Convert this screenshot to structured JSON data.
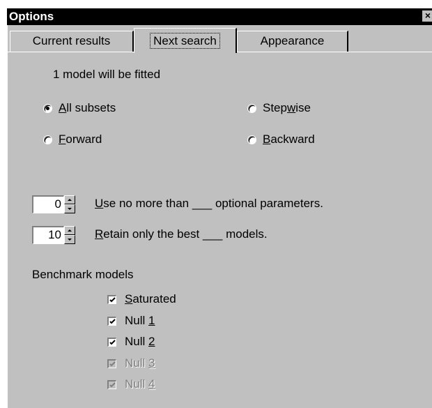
{
  "window": {
    "title": "Options",
    "close_glyph": "×"
  },
  "tabs": [
    {
      "label": "Current results",
      "active": false
    },
    {
      "label": "Next search",
      "active": true
    },
    {
      "label": "Appearance",
      "active": false
    }
  ],
  "summary": "1 model will be fitted",
  "method": {
    "options": [
      {
        "pre": "",
        "key": "A",
        "post": "ll subsets",
        "selected": true
      },
      {
        "pre": "Step",
        "key": "w",
        "post": "ise",
        "selected": false
      },
      {
        "pre": "",
        "key": "F",
        "post": "orward",
        "selected": false
      },
      {
        "pre": "",
        "key": "B",
        "post": "ackward",
        "selected": false
      }
    ]
  },
  "limits": {
    "max_optional": {
      "value": "0",
      "key": "U",
      "label_rest": "se no more than ___ optional parameters."
    },
    "retain_best": {
      "value": "10",
      "key": "R",
      "label_rest": "etain only the best ___ models."
    }
  },
  "benchmark": {
    "heading": "Benchmark models",
    "items": [
      {
        "pre": "",
        "key": "S",
        "post": "aturated",
        "checked": true,
        "enabled": true
      },
      {
        "pre": "Null ",
        "key": "1",
        "post": "",
        "checked": true,
        "enabled": true
      },
      {
        "pre": "Null ",
        "key": "2",
        "post": "",
        "checked": true,
        "enabled": true
      },
      {
        "pre": "Null ",
        "key": "3",
        "post": "",
        "checked": true,
        "enabled": false
      },
      {
        "pre": "Null ",
        "key": "4",
        "post": "",
        "checked": true,
        "enabled": false
      }
    ]
  },
  "colors": {
    "face": "#c0c0c0",
    "titlebar": "#000000",
    "disabled_text": "#808080"
  }
}
